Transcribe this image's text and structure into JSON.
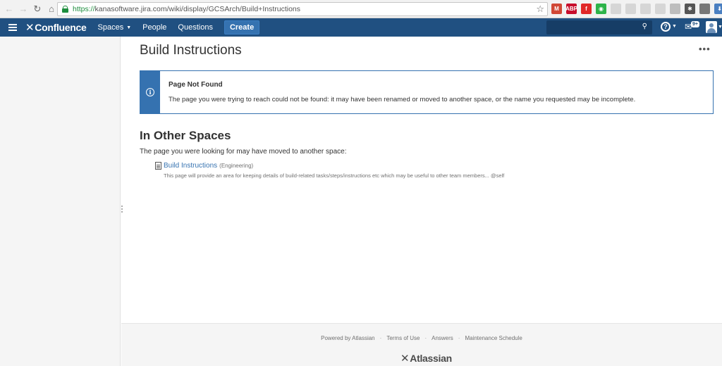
{
  "browser": {
    "url_scheme": "https://",
    "url_rest": "kanasoftware.jira.com/wiki/display/GCSArch/Build+Instructions",
    "extensions": [
      {
        "name": "gmail-icon",
        "label": "M",
        "color": "#d14836"
      },
      {
        "name": "adblock-icon",
        "label": "ABP",
        "color": "#c70d2c"
      },
      {
        "name": "flipboard-icon",
        "label": "f",
        "color": "#e12828"
      },
      {
        "name": "pushbullet-icon",
        "label": "◉",
        "color": "#2db34a"
      },
      {
        "name": "extension-gray-1-icon",
        "label": "",
        "color": "#d6d6d6"
      },
      {
        "name": "extension-gray-2-icon",
        "label": "",
        "color": "#d6d6d6"
      },
      {
        "name": "rss-icon",
        "label": "",
        "color": "#d6d6d6"
      },
      {
        "name": "extension-gray-3-icon",
        "label": "",
        "color": "#d6d6d6"
      },
      {
        "name": "extension-gray-4-icon",
        "label": "",
        "color": "#bdbdbd"
      },
      {
        "name": "settings-gear-icon",
        "label": "✱",
        "color": "#555555"
      },
      {
        "name": "extension-dark-icon",
        "label": "",
        "color": "#777777"
      },
      {
        "name": "download-icon",
        "label": "⬇",
        "color": "#4a7fc1"
      }
    ]
  },
  "header": {
    "logo_mark": "✕",
    "logo_text": "Confluence",
    "nav": {
      "spaces": "Spaces",
      "people": "People",
      "questions": "Questions"
    },
    "create": "Create",
    "help": "?",
    "notifications": "9+"
  },
  "page": {
    "title": "Build Instructions",
    "more": "•••"
  },
  "message": {
    "title": "Page Not Found",
    "text": "The page you were trying to reach could not be found: it may have been renamed or moved to another space, or the name you requested may be incomplete."
  },
  "other_spaces": {
    "title": "In Other Spaces",
    "subtitle": "The page you were looking for may have moved to another space:",
    "results": [
      {
        "link": "Build Instructions",
        "space": "(Engineering)",
        "excerpt": "This page will provide an area for keeping details of build-related tasks/steps/instructions etc which may be useful to other team members... @self"
      }
    ]
  },
  "footer": {
    "powered_by": "Powered by Atlassian",
    "terms": "Terms of Use",
    "answers": "Answers",
    "maintenance": "Maintenance Schedule",
    "separator": "·",
    "logo_mark": "✕",
    "logo_text": "Atlassian"
  }
}
